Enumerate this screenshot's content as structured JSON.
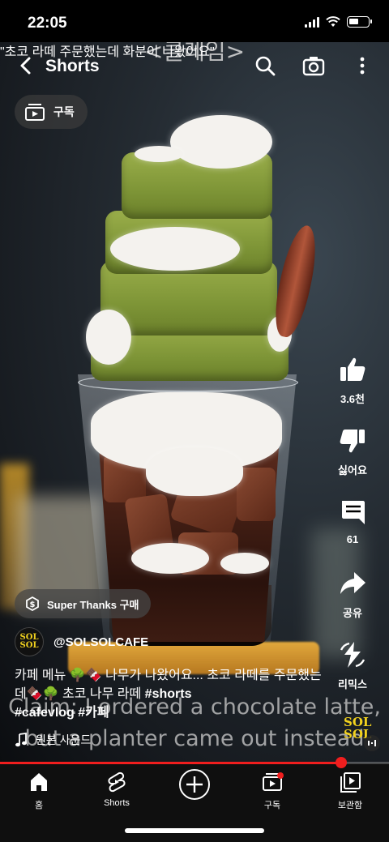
{
  "status_bar": {
    "time": "22:05"
  },
  "video_overlay_text": {
    "korean_top": "<클레임>",
    "korean_line": "\"초코 라떼 주문했는데 화분이 나왔어요\"",
    "english_line1": "Claim: I ordered a chocolate latte,",
    "english_line2": "but a planter came out instead"
  },
  "top_bar": {
    "title": "Shorts",
    "icons": [
      "back-arrow-icon",
      "search-icon",
      "camera-icon",
      "more-vertical-icon"
    ]
  },
  "subscriptions_chip": {
    "label": "구독",
    "icon": "subscriptions-icon"
  },
  "actions": {
    "like": {
      "label": "3.6천",
      "icon": "thumb-up-icon"
    },
    "dislike": {
      "label": "싫어요",
      "icon": "thumb-down-icon"
    },
    "comments": {
      "label": "61",
      "icon": "comment-icon"
    },
    "share": {
      "label": "공유",
      "icon": "share-icon"
    },
    "remix": {
      "label": "리믹스",
      "icon": "remix-icon"
    }
  },
  "super_thanks": {
    "label": "Super Thanks 구매",
    "icon": "super-thanks-icon"
  },
  "channel": {
    "handle": "@SOLSOLCAFE",
    "avatar_text": [
      "SOL",
      "SOL"
    ]
  },
  "description": {
    "text1": "카페 메뉴 🌳🍫 나무가 나왔어요... 초코 라떼를 주문했는데🍫🌳 초코 나무 라떼 ",
    "hashtag1": "#shorts",
    "hashtag2": "#cafevlog #카페"
  },
  "sound": {
    "label": "원본 사운드",
    "icon": "music-note-icon"
  },
  "remix_thumb": {
    "logo": [
      "SOL",
      "SOL"
    ]
  },
  "progress": {
    "fraction": 0.877
  },
  "bottom_nav": [
    {
      "label": "홈",
      "icon": "home-icon"
    },
    {
      "label": "Shorts",
      "icon": "shorts-icon"
    },
    {
      "label": "",
      "icon": "create-plus-icon"
    },
    {
      "label": "구독",
      "icon": "subscriptions-icon"
    },
    {
      "label": "보관함",
      "icon": "library-icon"
    }
  ],
  "colors": {
    "accent_red": "#f01e1e",
    "background": "#000000",
    "logo_yellow": "#f2d21e"
  }
}
